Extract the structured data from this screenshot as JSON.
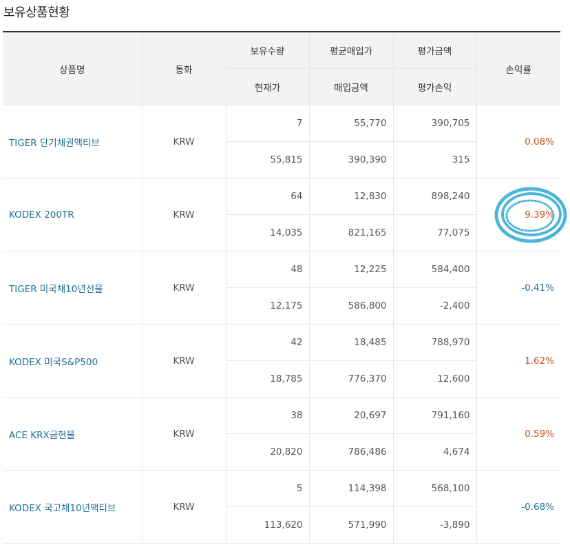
{
  "page_title": "보유상품현황",
  "table": {
    "headers": {
      "name": "상품명",
      "currency": "통화",
      "quantity": "보유수량",
      "avg_price": "평균매입가",
      "eval_amount": "평가금액",
      "profit_rate": "손익률",
      "current_price": "현재가",
      "purchase_amount": "매입금액",
      "eval_profit": "평가손익"
    },
    "rows": [
      {
        "name": "TIGER 단기채권액티브",
        "currency": "KRW",
        "quantity": "7",
        "avg_price": "55,770",
        "eval_amount": "390,705",
        "current_price": "55,815",
        "purchase_amount": "390,390",
        "eval_profit": "315",
        "profit_rate": "0.08%",
        "direction": "positive"
      },
      {
        "name": "KODEX 200TR",
        "currency": "KRW",
        "quantity": "64",
        "avg_price": "12,830",
        "eval_amount": "898,240",
        "current_price": "14,035",
        "purchase_amount": "821,165",
        "eval_profit": "77,075",
        "profit_rate": "9.39%",
        "direction": "positive"
      },
      {
        "name": "TIGER 미국채10년선물",
        "currency": "KRW",
        "quantity": "48",
        "avg_price": "12,225",
        "eval_amount": "584,400",
        "current_price": "12,175",
        "purchase_amount": "586,800",
        "eval_profit": "-2,400",
        "profit_rate": "-0.41%",
        "direction": "negative"
      },
      {
        "name": "KODEX 미국S&P500",
        "currency": "KRW",
        "quantity": "42",
        "avg_price": "18,485",
        "eval_amount": "788,970",
        "current_price": "18,785",
        "purchase_amount": "776,370",
        "eval_profit": "12,600",
        "profit_rate": "1.62%",
        "direction": "positive"
      },
      {
        "name": "ACE KRX금현물",
        "currency": "KRW",
        "quantity": "38",
        "avg_price": "20,697",
        "eval_amount": "791,160",
        "current_price": "20,820",
        "purchase_amount": "786,486",
        "eval_profit": "4,674",
        "profit_rate": "0.59%",
        "direction": "positive"
      },
      {
        "name": "KODEX 국고채10년액티브",
        "currency": "KRW",
        "quantity": "5",
        "avg_price": "114,398",
        "eval_amount": "568,100",
        "current_price": "113,620",
        "purchase_amount": "571,990",
        "eval_profit": "-3,890",
        "profit_rate": "-0.68%",
        "direction": "negative"
      }
    ]
  },
  "colors": {
    "link_name": "#1e6f94",
    "rate_positive": "#c8511b",
    "rate_negative": "#1e6f94",
    "header_background": "#f3f3f3",
    "highlight_marker": "#2ea8d6"
  }
}
